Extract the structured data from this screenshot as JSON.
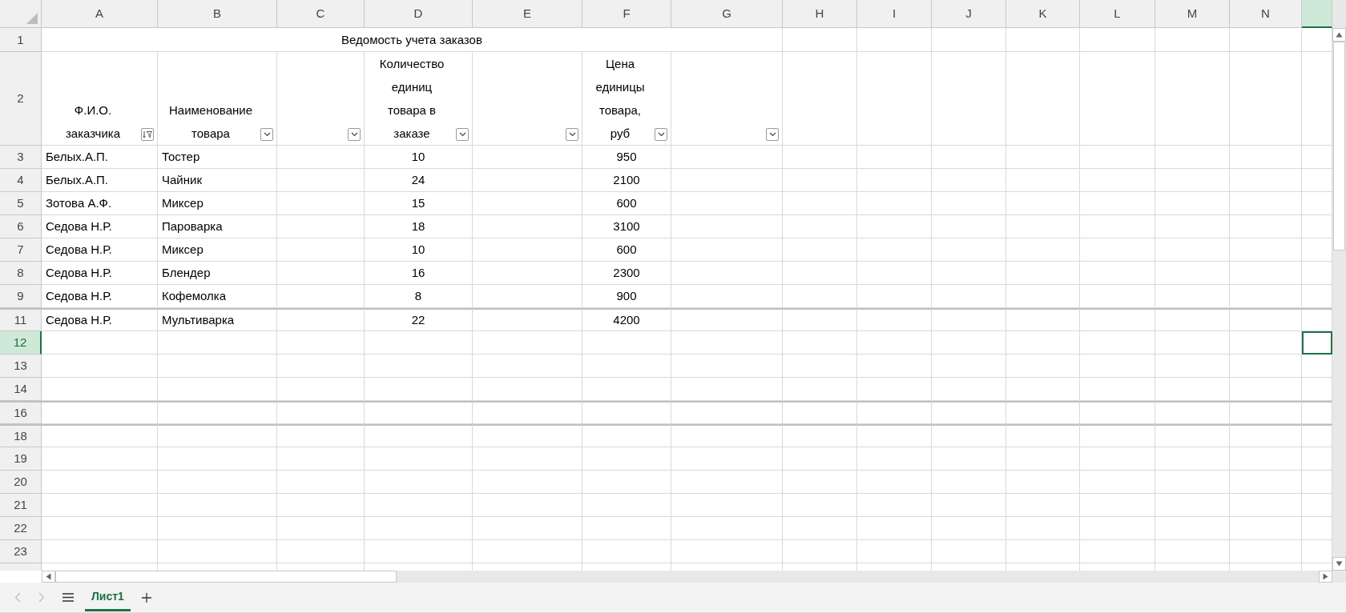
{
  "column_headers": [
    {
      "label": "A",
      "selected": false
    },
    {
      "label": "B",
      "selected": false
    },
    {
      "label": "C",
      "selected": false
    },
    {
      "label": "D",
      "selected": false
    },
    {
      "label": "E",
      "selected": false
    },
    {
      "label": "F",
      "selected": false
    },
    {
      "label": "G",
      "selected": false
    },
    {
      "label": "H",
      "selected": false
    },
    {
      "label": "I",
      "selected": false
    },
    {
      "label": "J",
      "selected": false
    },
    {
      "label": "K",
      "selected": false
    },
    {
      "label": "L",
      "selected": false
    },
    {
      "label": "M",
      "selected": false
    },
    {
      "label": "N",
      "selected": false
    },
    {
      "selected": true
    }
  ],
  "title_row": {
    "number": "1",
    "text": "Ведомость учета заказов"
  },
  "header_row": {
    "number": "2",
    "cells": [
      {
        "text": "Ф.И.О.\nзаказчика",
        "filter_active": true
      },
      {
        "text": "Наименование\nтовара",
        "filter_active": false
      },
      {
        "filter_active": false
      },
      {
        "text": "Количество\nединиц\nтовара в\nзаказе",
        "filter_active": false
      },
      {
        "filter_active": false
      },
      {
        "text": "Цена\nединицы\nтовара,\nруб",
        "filter_active": false
      },
      {
        "filter_active": false
      }
    ]
  },
  "rows": [
    {
      "number": "3",
      "selected": false,
      "hidden_above": false,
      "customer": "Белых.А.П.",
      "product": "Тостер",
      "quantity": "10",
      "price": "950"
    },
    {
      "number": "4",
      "selected": false,
      "hidden_above": false,
      "customer": "Белых.А.П.",
      "product": "Чайник",
      "quantity": "24",
      "price": "2100"
    },
    {
      "number": "5",
      "selected": false,
      "hidden_above": false,
      "customer": "Зотова А.Ф.",
      "product": "Миксер",
      "quantity": "15",
      "price": "600"
    },
    {
      "number": "6",
      "selected": false,
      "hidden_above": false,
      "customer": "Седова Н.Р.",
      "product": "Пароварка",
      "quantity": "18",
      "price": "3100"
    },
    {
      "number": "7",
      "selected": false,
      "hidden_above": false,
      "customer": "Седова Н.Р.",
      "product": "Миксер",
      "quantity": "10",
      "price": "600"
    },
    {
      "number": "8",
      "selected": false,
      "hidden_above": false,
      "customer": "Седова Н.Р.",
      "product": "Блендер",
      "quantity": "16",
      "price": "2300"
    },
    {
      "number": "9",
      "selected": false,
      "hidden_above": false,
      "customer": "Седова Н.Р.",
      "product": "Кофемолка",
      "quantity": "8",
      "price": "900"
    },
    {
      "number": "11",
      "selected": false,
      "hidden_above": true,
      "customer": "Седова Н.Р.",
      "product": "Мультиварка",
      "quantity": "22",
      "price": "4200"
    },
    {
      "number": "12",
      "selected": true,
      "hidden_above": false
    },
    {
      "number": "13",
      "selected": false,
      "hidden_above": false
    },
    {
      "number": "14",
      "selected": false,
      "hidden_above": false
    },
    {
      "number": "16",
      "selected": false,
      "hidden_above": true
    },
    {
      "number": "18",
      "selected": false,
      "hidden_above": true
    },
    {
      "number": "19",
      "selected": false,
      "hidden_above": false
    },
    {
      "number": "20",
      "selected": false,
      "hidden_above": false
    },
    {
      "number": "21",
      "selected": false,
      "hidden_above": false
    },
    {
      "number": "22",
      "selected": false,
      "hidden_above": false
    },
    {
      "number": "23",
      "selected": false,
      "hidden_above": false
    }
  ],
  "sheet_tabs": [
    {
      "label": "Лист1",
      "selected": true
    }
  ]
}
